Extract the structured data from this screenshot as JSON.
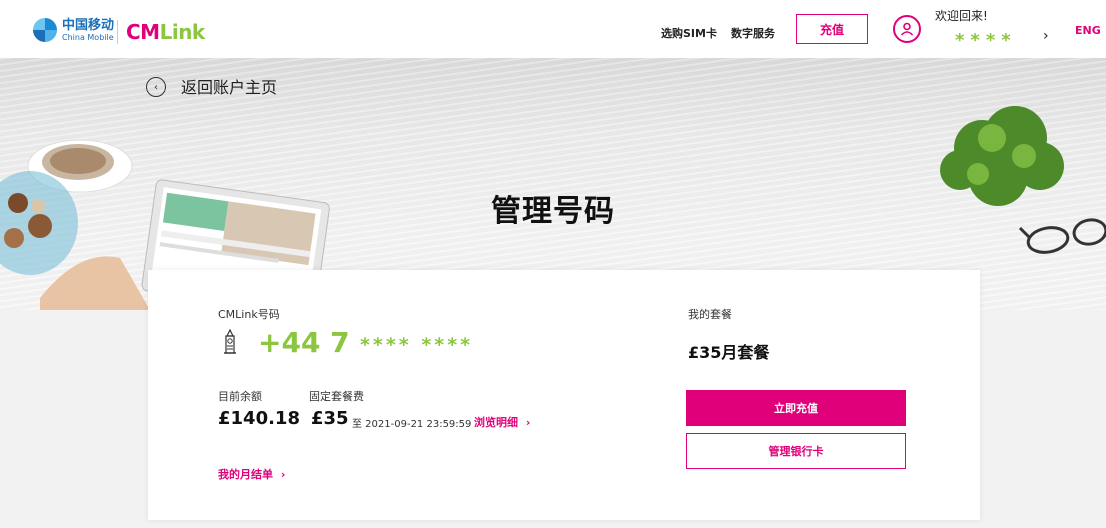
{
  "header": {
    "logo_cm_zh": "中国移动",
    "logo_cm_en": "China Mobile",
    "logo_cmlink_cm": "CM",
    "logo_cmlink_link": "Link",
    "nav": [
      "选购SIM卡",
      "数字服务"
    ],
    "recharge_label": "充值",
    "welcome": "欢迎回来!",
    "user_masked": "****",
    "lang": "ENG"
  },
  "hero": {
    "back_label": "返回账户主页",
    "title": "管理号码"
  },
  "card": {
    "number_label": "CMLink号码",
    "number_prefix": "+44 7",
    "number_masked": "**** ****",
    "balance_label": "目前余额",
    "balance_value": "£140.18",
    "fee_label": "固定套餐费",
    "fee_value": "£35",
    "fee_until": "至 2021-09-21 23:59:59",
    "browse_details": "浏览明细",
    "monthly_statement": "我的月结单",
    "plan_label": "我的套餐",
    "plan_name": "£35月套餐",
    "topup_now": "立即充值",
    "manage_card": "管理银行卡"
  },
  "colors": {
    "brand_pink": "#e0007a",
    "brand_green": "#8cc63f",
    "china_mobile_blue": "#1a6fb8"
  },
  "icons": [
    "china-mobile-logo-icon",
    "user-icon",
    "chevron-right-icon",
    "back-arrow-icon",
    "big-ben-icon"
  ]
}
